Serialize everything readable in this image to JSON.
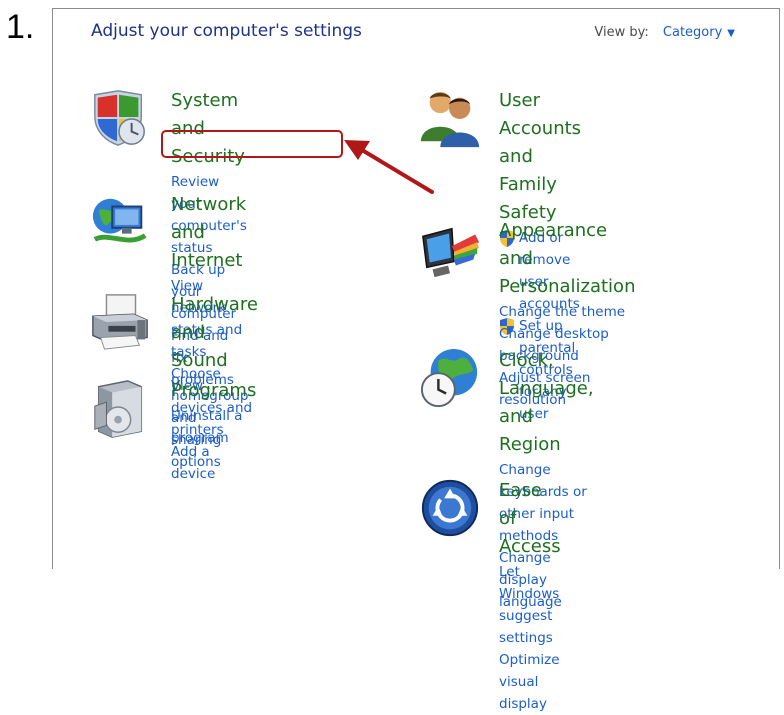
{
  "step_number": "1.",
  "panel": {
    "title": "Adjust your computer's settings",
    "view_by_label": "View by:",
    "view_by_value": "Category"
  },
  "categories": [
    {
      "title": "System and Security",
      "icon": "shield-flag-icon",
      "links": [
        "Review your computer's status",
        "Back up your computer",
        "Find and fix problems"
      ]
    },
    {
      "title": "Network and Internet",
      "icon": "network-globe-icon",
      "links": [
        "View network status and tasks",
        "Choose homegroup and sharing",
        "options"
      ]
    },
    {
      "title": "Hardware and Sound",
      "icon": "printer-icon",
      "links": [
        "View devices and printers",
        "Add a device"
      ]
    },
    {
      "title": "Programs",
      "icon": "programs-box-icon",
      "links": [
        "Uninstall a program"
      ]
    },
    {
      "title_line1": "User Accounts and Family",
      "title_line2": "Safety",
      "icon": "users-icon",
      "links": [
        "Add or remove user accounts",
        "Set up parental controls for any",
        "user"
      ]
    },
    {
      "title_line1": "Appearance and",
      "title_line2": "Personalization",
      "icon": "monitor-palette-icon",
      "links": [
        "Change the theme",
        "Change desktop background",
        "Adjust screen resolution"
      ]
    },
    {
      "title_line1": "Clock, Language, and",
      "title_line2": "Region",
      "icon": "globe-clock-icon",
      "links": [
        "Change keyboards or other input",
        "methods",
        "Change display language"
      ]
    },
    {
      "title": "Ease of Access",
      "icon": "ease-of-access-icon",
      "links": [
        "Let Windows suggest settings",
        "Optimize visual display"
      ]
    }
  ],
  "colors": {
    "title_blue": "#1e3287",
    "category_green": "#1e6f1e",
    "link_blue": "#1c5ec6",
    "annotation_red": "#b01818"
  }
}
